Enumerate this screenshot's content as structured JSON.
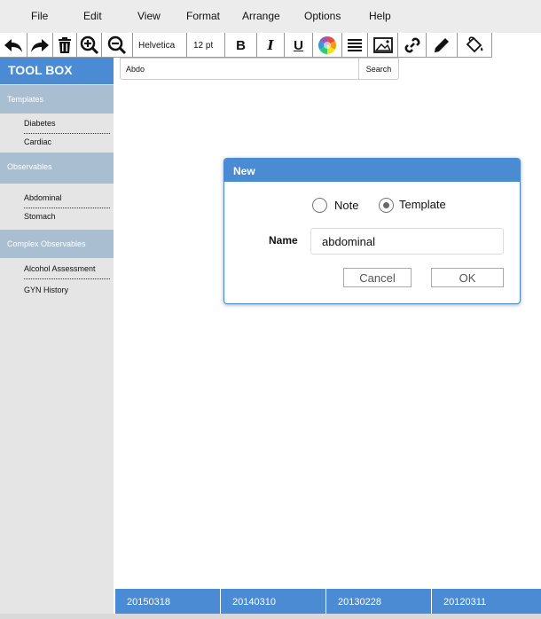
{
  "menubar": {
    "items": [
      "File",
      "Edit",
      "View",
      "Format",
      "Arrange",
      "Options",
      "Help"
    ]
  },
  "toolbar": {
    "font_family": "Helvetica",
    "font_size": "12 pt",
    "bold_label": "B",
    "italic_label": "I",
    "underline_label": "U",
    "icons": [
      "undo-icon",
      "redo-icon",
      "trash-icon",
      "zoom-in-icon",
      "zoom-out-icon",
      "color-wheel-icon",
      "align-icon",
      "image-icon",
      "link-icon",
      "pencil-icon",
      "paint-bucket-icon"
    ]
  },
  "sidebar": {
    "title": "TOOL BOX",
    "sections": [
      {
        "header": "Templates",
        "items": [
          "Diabetes",
          "Cardiac"
        ]
      },
      {
        "header": "Observables",
        "items": [
          "Abdominal",
          "Stomach"
        ]
      },
      {
        "header": "Complex Observables",
        "items": [
          "Alcohol Assessment",
          "GYN History"
        ]
      }
    ]
  },
  "search": {
    "value": "Abdo",
    "button_label": "Search"
  },
  "dialog": {
    "title": "New",
    "options": [
      {
        "label": "Note",
        "selected": false
      },
      {
        "label": "Template",
        "selected": true
      }
    ],
    "name_label": "Name",
    "name_value": "abdominal",
    "cancel_label": "Cancel",
    "ok_label": "OK"
  },
  "tabs": [
    "20150318",
    "20140310",
    "20130228",
    "20120311"
  ],
  "colors": {
    "accent": "#4a8bd4",
    "section_header": "#a9bed1",
    "sidebar_bg": "#e5e5e5",
    "menubar_bg": "#ececec"
  }
}
